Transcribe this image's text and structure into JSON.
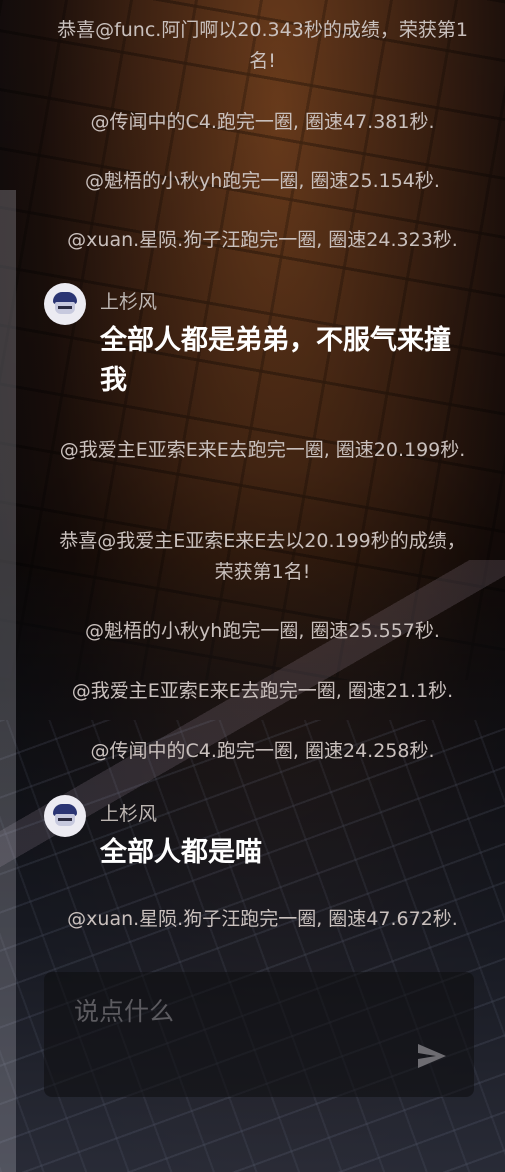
{
  "feed": {
    "system_messages": [
      "恭喜@func.阿门啊以20.343秒的成绩，荣获第1名!",
      "@传闻中的C4.跑完一圈, 圈速47.381秒.",
      "@魁梧的小秋yh跑完一圈, 圈速25.154秒.",
      "@xuan.星陨.狗子汪跑完一圈, 圈速24.323秒.",
      "@我爱主E亚索E来E去跑完一圈, 圈速20.199秒.",
      "恭喜@我爱主E亚索E来E去以20.199秒的成绩，荣获第1名!",
      "@魁梧的小秋yh跑完一圈, 圈速25.557秒.",
      "@我爱主E亚索E来E去跑完一圈, 圈速21.1秒.",
      "@传闻中的C4.跑完一圈, 圈速24.258秒.",
      "@xuan.星陨.狗子汪跑完一圈, 圈速47.672秒."
    ],
    "user_messages": [
      {
        "username": "上杉风",
        "text": "全部人都是弟弟，不服气来撞我"
      },
      {
        "username": "上杉风",
        "text": "全部人都是喵"
      }
    ]
  },
  "composer": {
    "placeholder": "说点什么"
  },
  "icons": {
    "send": "send-icon",
    "avatar": "avatar"
  },
  "colors": {
    "system_text": "#c9c0bd",
    "user_text": "#ffffff",
    "placeholder": "#5c5b60"
  }
}
